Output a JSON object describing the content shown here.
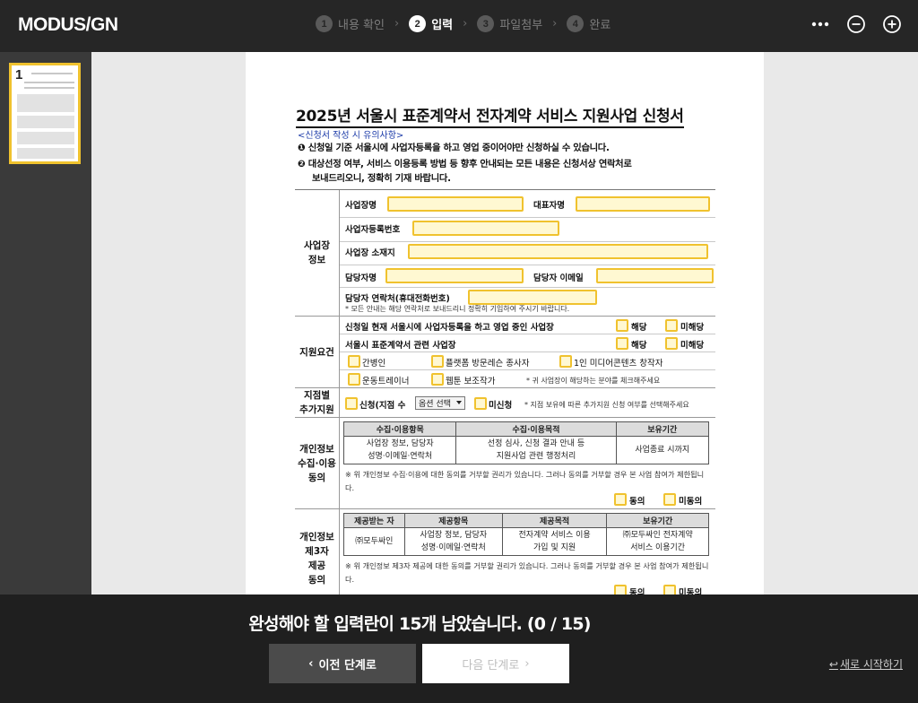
{
  "header": {
    "logo": "MODUS/GN",
    "steps": [
      {
        "num": "1",
        "label": "내용 확인"
      },
      {
        "num": "2",
        "label": "입력"
      },
      {
        "num": "3",
        "label": "파일첨부"
      },
      {
        "num": "4",
        "label": "완료"
      }
    ],
    "active_step": 2
  },
  "sidebar": {
    "page_number": "1"
  },
  "document": {
    "title": "2025년 서울시 표준계약서 전자계약 서비스 지원사업 신청서",
    "notice_title": "<신청서 작성 시 유의사항>",
    "notices": [
      "❶ 신청일 기준 서울시에 사업자등록을 하고 영업 중이어야만 신청하실 수 있습니다.",
      "❷ 대상선정 여부, 서비스 이용등록 방법 등 향후 안내되는 모든 내용은 신청서상 연락처로",
      "보내드리오니, 정확히 기재 바랍니다."
    ],
    "business_info": {
      "heading": "사업장\n정보",
      "business_name": "사업장명",
      "ceo_name": "대표자명",
      "reg_number": "사업자등록번호",
      "address": "사업장 소재지",
      "manager": "담당자명",
      "manager_email": "담당자 이메일",
      "manager_phone": "담당자 연락처(휴대전화번호)",
      "phone_note": "* 모든 안내는 해당 연락처로 보내드리니 정확히 기입하여 주시기 바랍니다."
    },
    "eligibility": {
      "heading": "지원요건",
      "q1": "신청일 현재 서울시에 사업자등록을 하고 영업 중인 사업장",
      "q2": "서울시 표준계약서 관련 사업장",
      "yes": "해당",
      "no": "미해당",
      "options": [
        "간병인",
        "플랫폼 방문레슨 종사자",
        "1인 미디어콘텐츠 창작자",
        "운동트레이너",
        "웹툰 보조작가"
      ],
      "options_note": "* 귀 사업장이 해당하는 분야를 체크해주세요"
    },
    "branch": {
      "heading": "지점별\n추가지원",
      "apply": "신청(지점 수",
      "select_value": "옵션 선택",
      "not_apply": "미신청",
      "note": "* 지점 보유에 따른 추가지원 신청 여부를 선택해주세요"
    },
    "privacy_collect": {
      "heading": "개인정보\n수집·이용\n동의",
      "headers": [
        "수집·이용항목",
        "수집·이용목적",
        "보유기간"
      ],
      "row": [
        "사업장 정보, 담당자\n성명·이메일·연락처",
        "선정 심사, 신청 결과 안내 등\n지원사업 관련 행정처리",
        "사업종료 시까지"
      ],
      "text": "※ 위 개인정보 수집·이용에 대한 동의를 거부할 권리가 있습니다. 그러나 동의를 거부할 경우 본 사업 참여가 제한됩니다.",
      "agree": "동의",
      "disagree": "미동의"
    },
    "privacy_third": {
      "heading": "개인정보\n제3자\n제공\n동의",
      "headers": [
        "제공받는 자",
        "제공항목",
        "제공목적",
        "보유기간"
      ],
      "row": [
        "㈜모두싸인",
        "사업장 정보, 담당자\n성명·이메일·연락처",
        "전자계약 서비스 이용\n가입 및 지원",
        "㈜모두싸인 전자계약\n서비스 이용기간"
      ],
      "text": "※ 위 개인정보 제3자 제공에 대한 동의를 거부할 권리가 있습니다. 그러나 동의를 거부할 경우 본 사업 참여가 제한됩니다.",
      "agree": "동의",
      "disagree": "미동의"
    }
  },
  "footer": {
    "remaining": "완성해야 할 입력란이 15개 남았습니다. (0 / 15)",
    "prev_button": "이전 단계로",
    "next_button": "다음 단계로",
    "restart": "새로 시작하기"
  },
  "colors": {
    "field_border": "#f0c22e",
    "field_fill": "#fff8d2",
    "topbar": "#262626",
    "bottombar": "#1f1f1f"
  }
}
